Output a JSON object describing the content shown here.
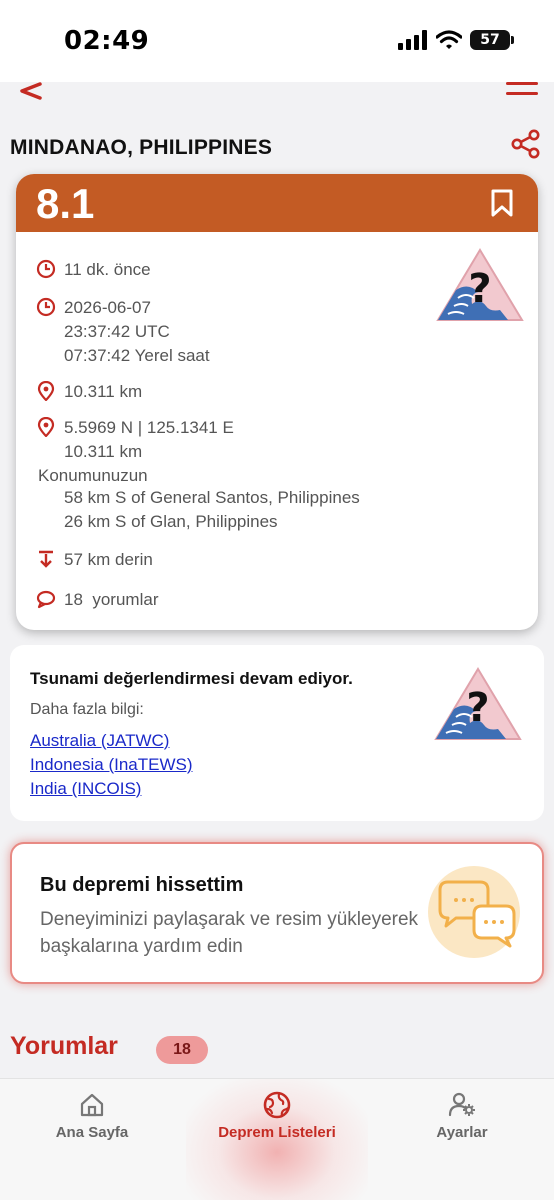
{
  "status_bar": {
    "time": "02:49",
    "battery": "57"
  },
  "header": {
    "location": "MINDANAO, PHILIPPINES"
  },
  "quake": {
    "magnitude": "8.1",
    "time_ago": "11 dk. önce",
    "date": "2026-06-07",
    "utc_time": "23:37:42 UTC",
    "local_time": "07:37:42 Yerel saat",
    "distance": "10.311 km",
    "coordinates": "5.5969 N | 125.1341 E",
    "coord_distance": "10.311 km",
    "location_label": "Konumunuzun",
    "nearby": [
      "58 km S of General Santos, Philippines",
      "26 km S of Glan, Philippines"
    ],
    "depth": "57 km derin",
    "comments": "18  yorumlar"
  },
  "tsunami": {
    "title": "Tsunami değerlendirmesi devam ediyor.",
    "subtitle": "Daha fazla bilgi:",
    "links": [
      "Australia (JATWC)",
      "Indonesia (InaTEWS)",
      "India (INCOIS)"
    ]
  },
  "felt": {
    "title": "Bu depremi hissettim",
    "description": "Deneyiminizi paylaşarak ve resim yükleyerek başkalarına yardım edin"
  },
  "comments_section": {
    "title": "Yorumlar",
    "count": "18"
  },
  "tabs": [
    {
      "label": "Ana Sayfa",
      "icon": "home-icon"
    },
    {
      "label": "Deprem Listeleri",
      "icon": "globe-icon"
    },
    {
      "label": "Ayarlar",
      "icon": "user-settings-icon"
    }
  ],
  "colors": {
    "accent": "#c42b23",
    "magnitude_header": "#c35b24",
    "link": "#1a29c9"
  }
}
